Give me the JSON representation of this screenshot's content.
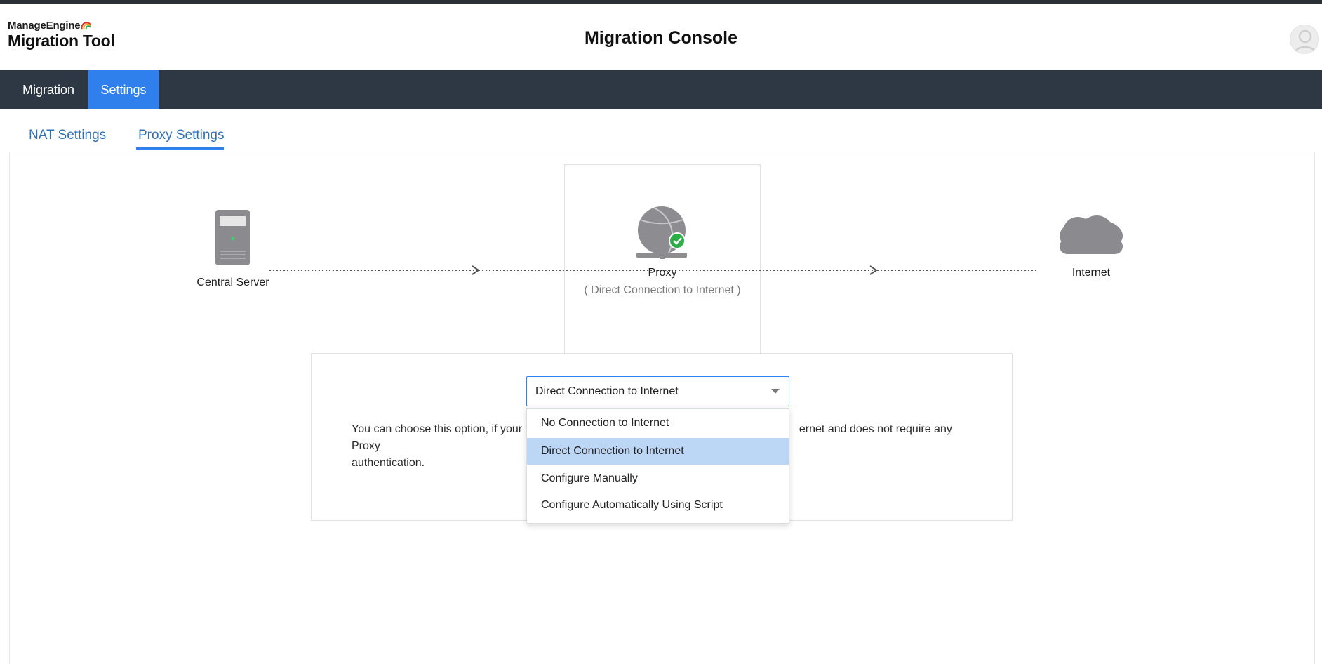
{
  "brand": {
    "small": "ManageEngine",
    "large": "Migration Tool"
  },
  "header": {
    "title": "Migration Console"
  },
  "nav": {
    "items": [
      {
        "label": "Migration"
      },
      {
        "label": "Settings"
      }
    ]
  },
  "subtabs": [
    {
      "label": "NAT Settings"
    },
    {
      "label": "Proxy Settings"
    }
  ],
  "diagram": {
    "central_server": "Central Server",
    "proxy": "Proxy",
    "proxy_mode": "( Direct Connection to Internet )",
    "internet": "Internet"
  },
  "proxy_select": {
    "value": "Direct Connection to Internet",
    "options": [
      "No Connection to Internet",
      "Direct Connection to Internet",
      "Configure Manually",
      "Configure Automatically Using Script"
    ],
    "selected_option": "Direct Connection to Internet"
  },
  "panel": {
    "text_left_line1": "You can choose this option, if your M",
    "text_right_line1": "ernet and does not require any Proxy",
    "text_line2": "authentication."
  },
  "colors": {
    "accent": "#2f80ed",
    "navbar": "#2e3744",
    "selected_option_bg": "#bcd6f6",
    "check_badge": "#2fae4a"
  },
  "icons": {
    "server": "server-icon",
    "proxy": "globe-network-icon",
    "check": "check-circle-icon",
    "internet": "cloud-icon",
    "avatar": "user-avatar-icon",
    "caret": "chevron-down-icon"
  }
}
